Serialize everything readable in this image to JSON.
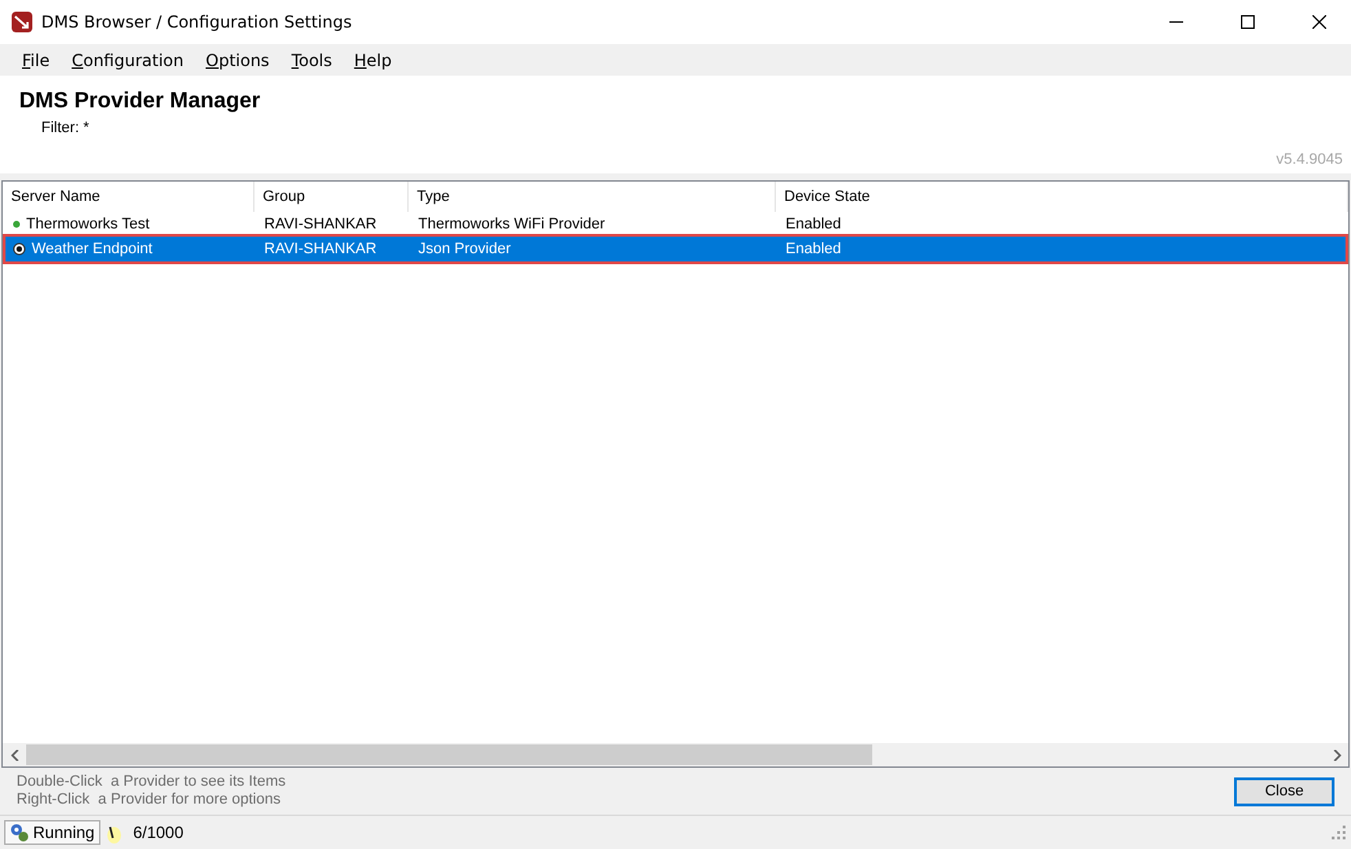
{
  "window": {
    "title": "DMS Browser / Configuration Settings"
  },
  "menu": [
    "File",
    "Configuration",
    "Options",
    "Tools",
    "Help"
  ],
  "header": {
    "title": "DMS Provider Manager",
    "filter": "Filter: *",
    "version": "v5.4.9045"
  },
  "table": {
    "columns": [
      "Server Name",
      "Group",
      "Type",
      "Device State"
    ],
    "rows": [
      {
        "kind": "dot",
        "selected": false,
        "cells": [
          "Thermoworks Test",
          "RAVI-SHANKAR",
          "Thermoworks WiFi Provider",
          "Enabled"
        ]
      },
      {
        "kind": "ring",
        "selected": true,
        "cells": [
          "Weather Endpoint",
          "RAVI-SHANKAR",
          "Json Provider",
          "Enabled"
        ]
      }
    ]
  },
  "hints": [
    "Double-Click  a Provider to see its Items",
    "Right-Click  a Provider for more options"
  ],
  "close_button": "Close",
  "status_bar": {
    "state": "Running",
    "count": "6/1000"
  }
}
